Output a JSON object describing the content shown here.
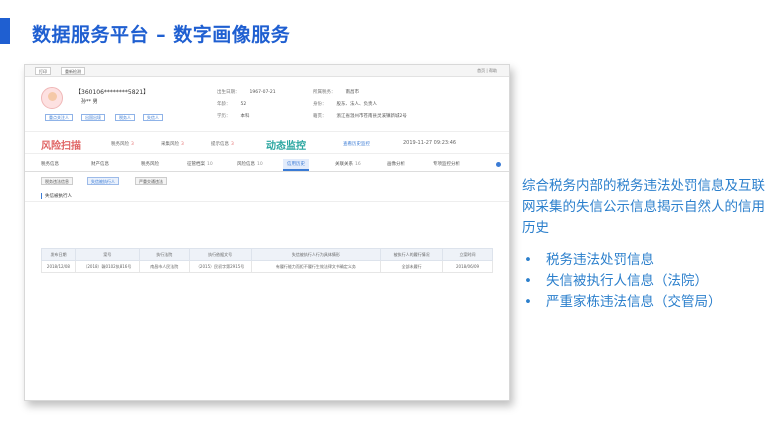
{
  "slide": {
    "title": "数据服务平台 – 数字画像服务",
    "description": "综合税务内部的税务违法处罚信息及互联网采集的失信公示信息揭示自然人的信用历史",
    "bullets": [
      "税务违法处罚信息",
      "失信被执行人信息（法院）",
      "严重家栋违法信息（交管局）"
    ],
    "bullet_glyph": "•",
    "colors": {
      "accent": "#1f5fd1",
      "text_blue": "#2b7fcc",
      "risk_red": "#e06666",
      "monitor_teal": "#2aa6a0"
    }
  },
  "screenshot": {
    "topbar": {
      "btn1": "打印",
      "btn2": "重新检测",
      "right": "首页 | 帮助"
    },
    "profile": {
      "id": "【360106********5821】",
      "name": "孙**   男",
      "tags": [
        "重点关注人",
        "出国出境",
        "税务人",
        "失信人"
      ],
      "fields": [
        {
          "label": "出生日期：",
          "value": "1967-07-21"
        },
        {
          "label": "年龄：",
          "value": "52"
        },
        {
          "label": "学历：",
          "value": "本科"
        },
        {
          "label": "所属税务：",
          "value": "南昌市"
        },
        {
          "label": "身份：",
          "value": "股东、法人、负责人"
        },
        {
          "label": "籍贯：",
          "value": "浙江省温州市苍南县灵溪镇新城2号"
        }
      ]
    },
    "risk": {
      "title": "风险扫描",
      "items": [
        {
          "label": "税务风险",
          "count": "3"
        },
        {
          "label": "采集风险",
          "count": "3"
        },
        {
          "label": "提示信息",
          "count": "3"
        }
      ],
      "monitor_title": "动态监控",
      "history_link": "查看历史监控",
      "timestamp": "2019-11-27 09:23:46"
    },
    "tabs": [
      {
        "label": "税务信息",
        "count": ""
      },
      {
        "label": "财产信息",
        "count": ""
      },
      {
        "label": "税务风险",
        "count": ""
      },
      {
        "label": "征管档案",
        "count": "10"
      },
      {
        "label": "风险信息",
        "count": "10"
      },
      {
        "label": "信用历史",
        "count": ""
      },
      {
        "label": "关联关系",
        "count": "16"
      },
      {
        "label": "画像分析",
        "count": ""
      },
      {
        "label": "专项监控分析",
        "count": ""
      }
    ],
    "subtabs": [
      "税务违法信息",
      "失信被执行人",
      "严重交通违法"
    ],
    "section_title": "失信被执行人",
    "table": {
      "headers": [
        "发布日期",
        "案号",
        "执行法院",
        "执行依据文号",
        "失信被执行人行为具体情形",
        "被执行人的履行情况",
        "立案时间"
      ],
      "rows": [
        [
          "2018/12/08",
          "（2018）赣0102执816号",
          "南昌市人民法院",
          "（2015）民初字第2915号",
          "有履行能力而拒不履行生效法律文书确定义务",
          "全部未履行",
          "2018/06/09"
        ]
      ]
    }
  }
}
